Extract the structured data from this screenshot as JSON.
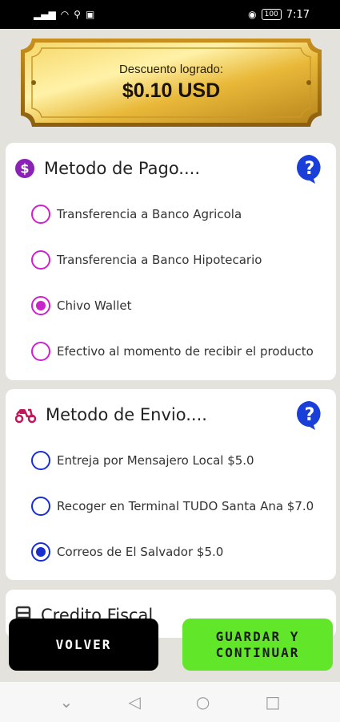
{
  "status_bar": {
    "time": "7:17",
    "battery": "100"
  },
  "discount": {
    "label": "Descuento logrado:",
    "amount": "$0.10 USD"
  },
  "payment": {
    "title": "Metodo de Pago....",
    "options": [
      {
        "label": "Transferencia a Banco Agricola",
        "selected": false
      },
      {
        "label": "Transferencia a Banco Hipotecario",
        "selected": false
      },
      {
        "label": "Chivo Wallet",
        "selected": true
      },
      {
        "label": "Efectivo al momento de recibir el producto",
        "selected": false
      }
    ]
  },
  "shipping": {
    "title": "Metodo de Envio....",
    "options": [
      {
        "label": "Entreja por Mensajero Local $5.0",
        "selected": false
      },
      {
        "label": "Recoger en Terminal TUDO Santa Ana $7.0",
        "selected": false
      },
      {
        "label": "Correos de El Salvador $5.0",
        "selected": true
      }
    ]
  },
  "fiscal": {
    "title": "Credito Fiscal"
  },
  "buttons": {
    "back": "VOLVER",
    "save_line1": "GUARDAR Y",
    "save_line2": "CONTINUAR"
  },
  "colors": {
    "payment_accent": "#cc22cc",
    "shipping_accent": "#1a2fd0",
    "save_button": "#62e62a",
    "help_icon": "#1a3fd8"
  },
  "icons": {
    "payment": "dollar-circle-icon",
    "shipping": "scooter-icon",
    "fiscal": "receipt-icon",
    "help": "question-bubble-icon"
  }
}
